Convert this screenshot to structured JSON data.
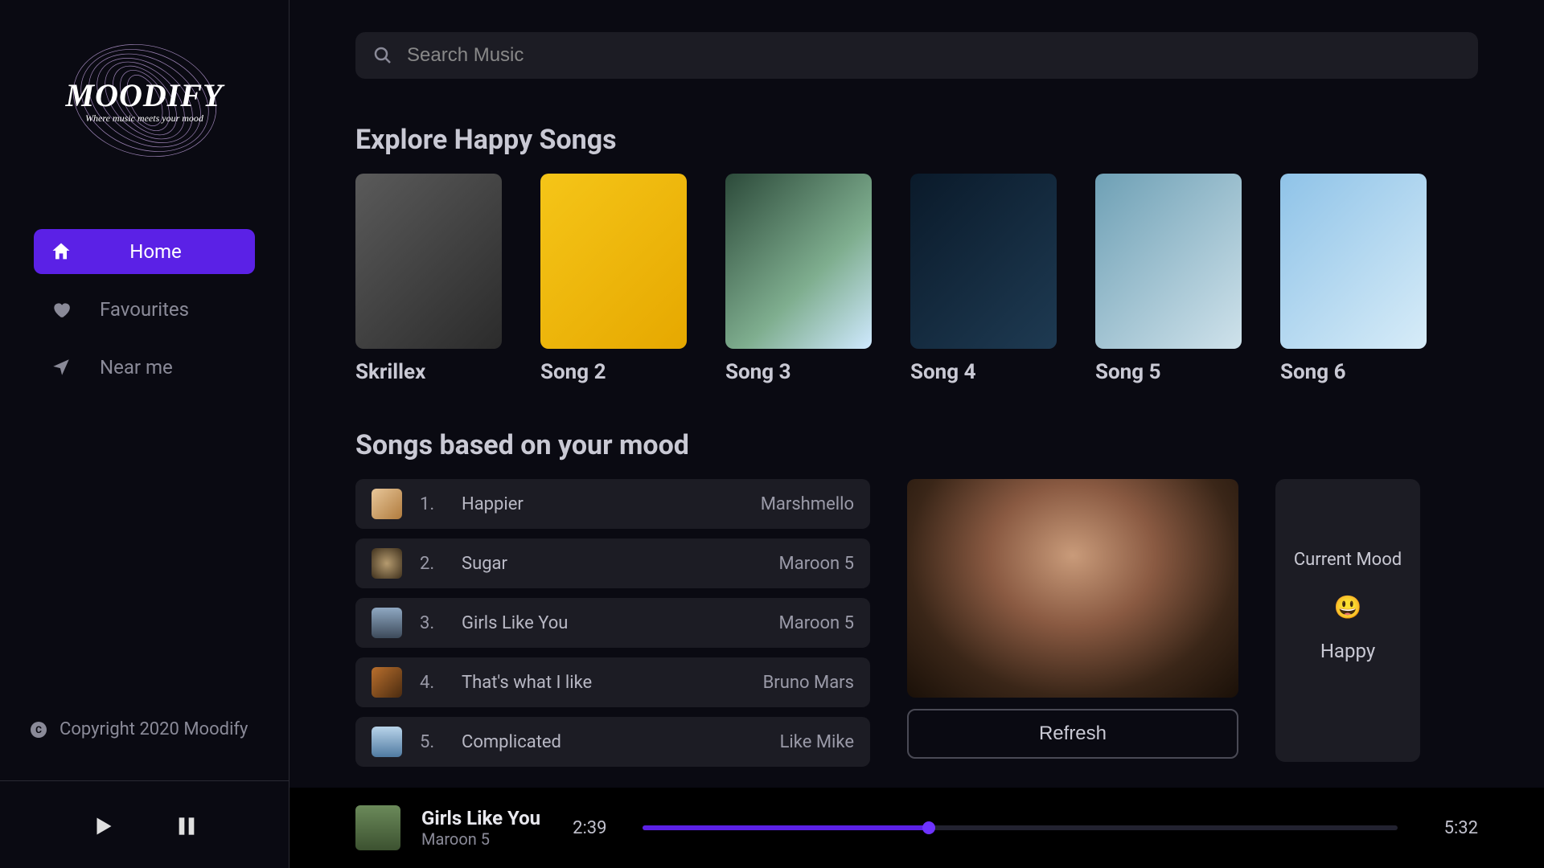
{
  "brand": {
    "name": "MOODIFY",
    "tagline": "Where music meets your mood"
  },
  "sidebar": {
    "items": [
      {
        "label": "Home",
        "icon": "home-icon",
        "active": true
      },
      {
        "label": "Favourites",
        "icon": "heart-icon",
        "active": false
      },
      {
        "label": "Near me",
        "icon": "location-arrow-icon",
        "active": false
      }
    ]
  },
  "copyright": "Copyright 2020 Moodify",
  "search": {
    "placeholder": "Search Music"
  },
  "explore": {
    "title": "Explore Happy Songs",
    "songs": [
      {
        "title": "Skrillex"
      },
      {
        "title": "Song 2"
      },
      {
        "title": "Song 3"
      },
      {
        "title": "Song 4"
      },
      {
        "title": "Song 5"
      },
      {
        "title": "Song 6"
      }
    ]
  },
  "moodList": {
    "title": "Songs based on your mood",
    "tracks": [
      {
        "n": "1.",
        "name": "Happier",
        "artist": "Marshmello"
      },
      {
        "n": "2.",
        "name": "Sugar",
        "artist": "Maroon 5"
      },
      {
        "n": "3.",
        "name": "Girls Like You",
        "artist": "Maroon 5"
      },
      {
        "n": "4.",
        "name": "That's what I like",
        "artist": "Bruno Mars"
      },
      {
        "n": "5.",
        "name": "Complicated",
        "artist": "Like Mike"
      }
    ]
  },
  "moodPanel": {
    "refresh_label": "Refresh",
    "heading": "Current Mood",
    "emoji": "😃",
    "mood": "Happy"
  },
  "player": {
    "title": "Girls Like You",
    "artist": "Maroon 5",
    "elapsed": "2:39",
    "total": "5:32",
    "progress_pct": 38
  },
  "colors": {
    "accent": "#5b21e6"
  }
}
